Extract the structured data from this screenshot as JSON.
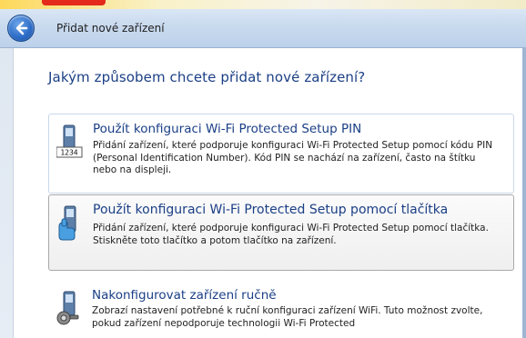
{
  "window": {
    "title": "Přidat nové zařízení"
  },
  "main": {
    "heading": "Jakým způsobem chcete přidat nové zařízení?",
    "options": [
      {
        "title": "Použít konfiguraci Wi-Fi Protected Setup PIN",
        "description": "Přidání zařízení, které podporuje konfiguraci Wi-Fi Protected Setup pomocí kódu PIN (Personal Identification Number). Kód PIN se nachází na zařízení, často na štítku nebo na displeji.",
        "icon": "pin-code-device-icon",
        "icon_text": "1234"
      },
      {
        "title": "Použít konfiguraci Wi-Fi Protected Setup pomocí tlačítka",
        "description": "Přidání zařízení, které podporuje konfiguraci Wi-Fi Protected Setup pomocí tlačítka. Stiskněte toto tlačítko a potom tlačítko na zařízení.",
        "icon": "push-button-device-icon"
      },
      {
        "title": "Nakonfigurovat zařízení ručně",
        "description": "Zobrazí nastavení potřebné k ruční konfiguraci zařízení WiFi. Tuto možnost zvolte, pokud zařízení nepodporuje technologii Wi-Fi Protected",
        "icon": "manual-config-device-icon"
      }
    ]
  },
  "colors": {
    "heading": "#1b3f86",
    "titlebar": "#c9daee",
    "accent_red": "#e42a1a"
  }
}
